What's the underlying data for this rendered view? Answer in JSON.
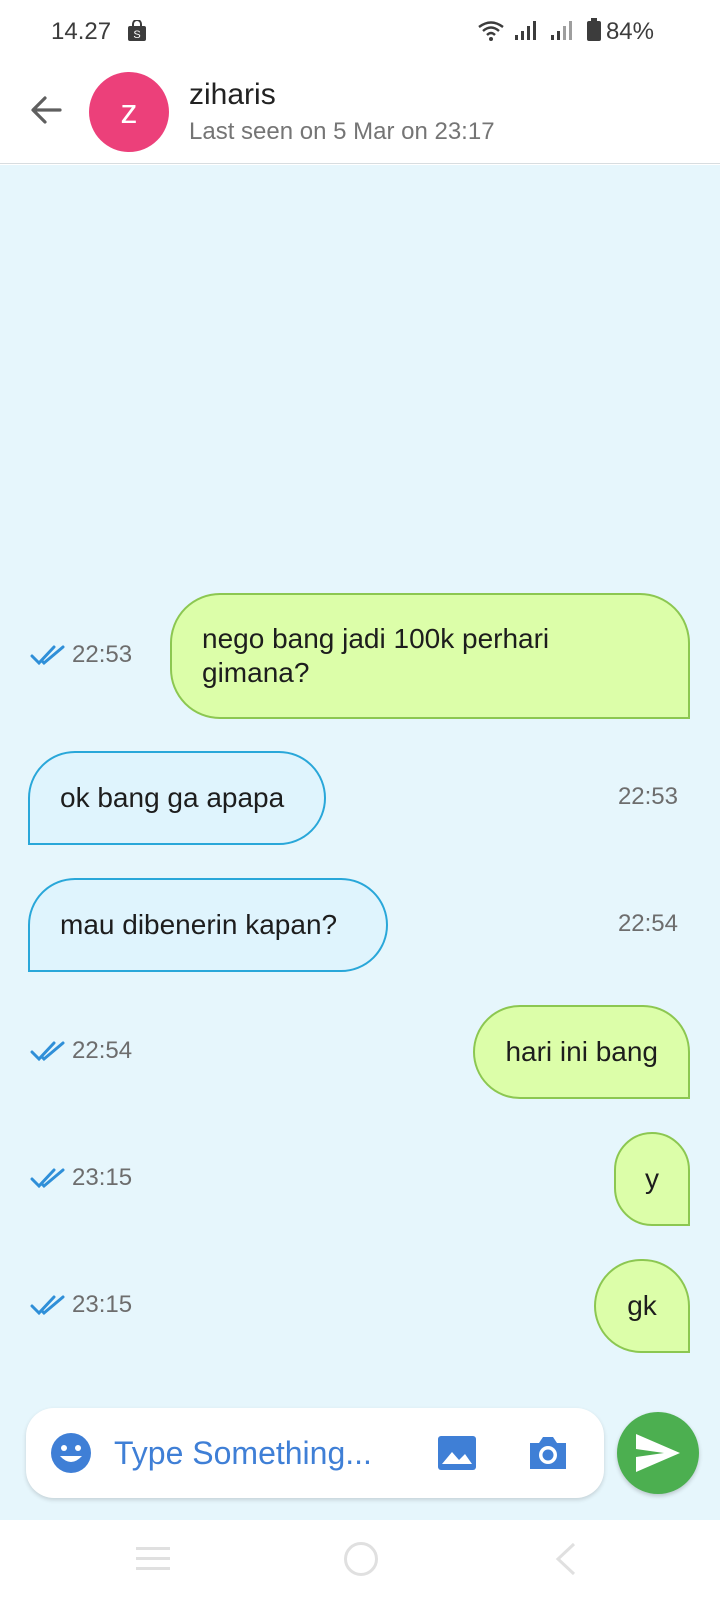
{
  "status_bar": {
    "time": "14.27",
    "battery": "84%"
  },
  "header": {
    "avatar_letter": "z",
    "contact_name": "ziharis",
    "last_seen": "Last seen on 5 Mar on 23:17"
  },
  "messages": [
    {
      "direction": "out",
      "text": "nego bang jadi 100k perhari gimana?",
      "time": "22:53",
      "read": true
    },
    {
      "direction": "in",
      "text": "ok bang ga apapa",
      "time": "22:53"
    },
    {
      "direction": "in",
      "text": "mau dibenerin kapan?",
      "time": "22:54"
    },
    {
      "direction": "out",
      "text": "hari ini bang",
      "time": "22:54",
      "read": true
    },
    {
      "direction": "out",
      "text": "y",
      "time": "23:15",
      "read": true
    },
    {
      "direction": "out",
      "text": "gk",
      "time": "23:15",
      "read": true
    }
  ],
  "composer": {
    "placeholder": "Type Something...",
    "value": ""
  },
  "colors": {
    "outgoing_bubble": "#dcfea9",
    "outgoing_border": "#8cc751",
    "incoming_bubble": "#dff4fd",
    "incoming_border": "#29a7d9",
    "chat_background": "#e6f6fc",
    "avatar": "#ec407a",
    "send_button": "#4caf50",
    "read_ticks": "#2f8fd8"
  },
  "icons": {
    "back": "arrow-back-icon",
    "emoji": "emoji-icon",
    "gallery": "image-icon",
    "camera": "camera-icon",
    "send": "send-icon",
    "read": "double-check-icon"
  }
}
